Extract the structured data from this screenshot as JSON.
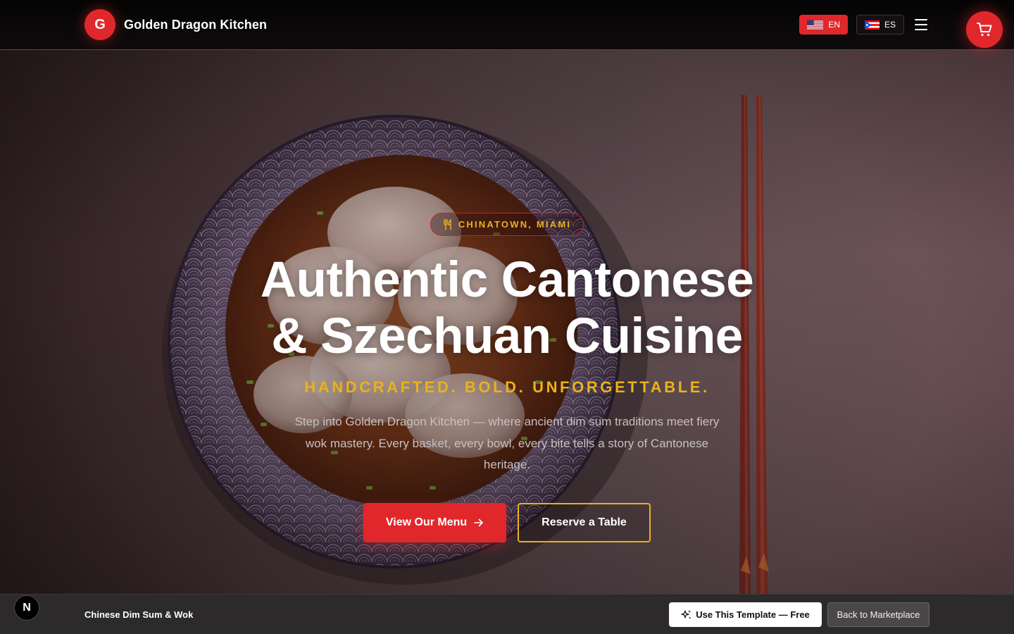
{
  "nav": {
    "logo_letter": "G",
    "brand_name": "Golden Dragon Kitchen",
    "languages": [
      {
        "code": "EN",
        "flag_icon": "us-flag-icon",
        "active": true
      },
      {
        "code": "ES",
        "flag_icon": "puerto-rico-flag-icon",
        "active": false
      }
    ],
    "menu_icon": "hamburger-menu-icon",
    "cart_icon": "shopping-cart-icon"
  },
  "hero": {
    "location_icon": "utensils-icon",
    "location": "CHINATOWN, MIAMI",
    "title_line1": "Authentic Cantonese",
    "title_line2": "& Szechuan Cuisine",
    "tagline": "HANDCRAFTED. BOLD. UNFORGETTABLE.",
    "description": "Step into Golden Dragon Kitchen — where ancient dim sum traditions meet fiery wok mastery. Every basket, every bowl, every bite tells a story of Cantonese heritage.",
    "primary_button": "View Our Menu",
    "primary_button_icon": "arrow-right-icon",
    "secondary_button": "Reserve a Table"
  },
  "bottom_bar": {
    "badge_letter": "N",
    "template_name": "Chinese Dim Sum & Wok",
    "use_template_icon": "sparkles-icon",
    "use_template_label": "Use This Template — Free",
    "back_label": "Back to Marketplace"
  },
  "colors": {
    "accent_red": "#e0282c",
    "accent_gold": "#e8b21c",
    "nav_bg": "#0a0708",
    "bottom_bar_bg": "#2c2a2b"
  }
}
